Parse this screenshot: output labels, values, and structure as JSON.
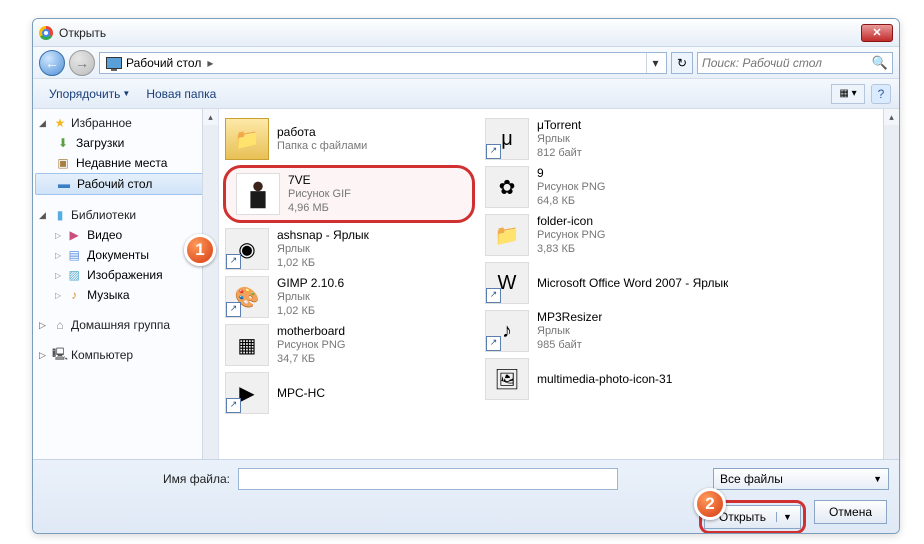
{
  "window": {
    "title": "Открыть"
  },
  "nav": {
    "location": "Рабочий стол",
    "search_placeholder": "Поиск: Рабочий стол"
  },
  "toolbar": {
    "organize": "Упорядочить",
    "new_folder": "Новая папка"
  },
  "sidebar": {
    "favorites": {
      "label": "Избранное",
      "items": [
        {
          "label": "Загрузки"
        },
        {
          "label": "Недавние места"
        },
        {
          "label": "Рабочий стол"
        }
      ]
    },
    "libraries": {
      "label": "Библиотеки",
      "items": [
        {
          "label": "Видео"
        },
        {
          "label": "Документы"
        },
        {
          "label": "Изображения"
        },
        {
          "label": "Музыка"
        }
      ]
    },
    "homegroup": {
      "label": "Домашняя группа"
    },
    "computer": {
      "label": "Компьютер"
    }
  },
  "files": {
    "left": [
      {
        "name": "работа",
        "type": "Папка с файлами",
        "size": "",
        "kind": "folder"
      },
      {
        "name": "7VE",
        "type": "Рисунок GIF",
        "size": "4,96 МБ",
        "kind": "gif",
        "hl": true
      },
      {
        "name": "ashsnap - Ярлык",
        "type": "Ярлык",
        "size": "1,02 КБ",
        "kind": "shortcut"
      },
      {
        "name": "GIMP 2.10.6",
        "type": "Ярлык",
        "size": "1,02 КБ",
        "kind": "shortcut"
      },
      {
        "name": "motherboard",
        "type": "Рисунок PNG",
        "size": "34,7 КБ",
        "kind": "png"
      },
      {
        "name": "MPC-HC",
        "type": "",
        "size": "",
        "kind": "shortcut"
      }
    ],
    "right": [
      {
        "name": "μTorrent",
        "type": "Ярлык",
        "size": "812 байт",
        "kind": "shortcut"
      },
      {
        "name": "9",
        "type": "Рисунок PNG",
        "size": "64,8 КБ",
        "kind": "png"
      },
      {
        "name": "folder-icon",
        "type": "Рисунок PNG",
        "size": "3,83 КБ",
        "kind": "png"
      },
      {
        "name": "Microsoft Office Word 2007 - Ярлык",
        "type": "",
        "size": "",
        "kind": "shortcut"
      },
      {
        "name": "MP3Resizer",
        "type": "Ярлык",
        "size": "985 байт",
        "kind": "shortcut"
      },
      {
        "name": "multimedia-photo-icon-31",
        "type": "",
        "size": "",
        "kind": "png"
      }
    ]
  },
  "footer": {
    "filename_label": "Имя файла:",
    "filename_value": "",
    "filter": "Все файлы",
    "open": "Открыть",
    "cancel": "Отмена"
  },
  "badges": {
    "one": "1",
    "two": "2"
  }
}
